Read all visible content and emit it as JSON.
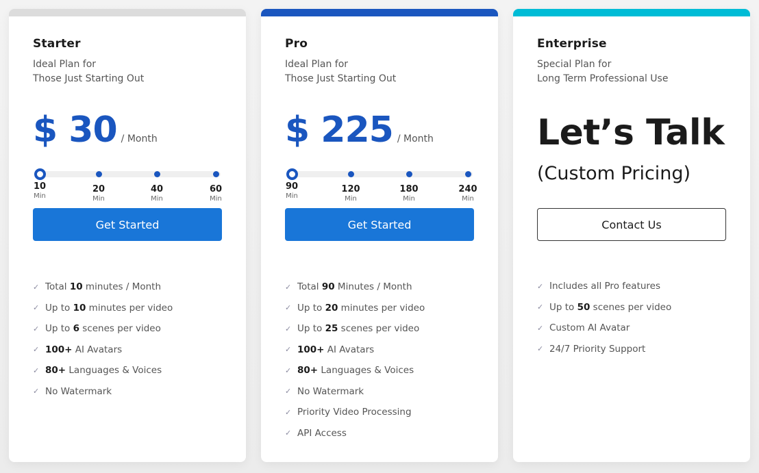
{
  "plans": [
    {
      "name": "Starter",
      "desc_line1": "Ideal Plan for",
      "desc_line2": "Those Just Starting Out",
      "price": "$ 30",
      "price_unit": "/ Month",
      "slider": {
        "selected_index": 0,
        "stops": [
          {
            "value": "10",
            "unit": "Min"
          },
          {
            "value": "20",
            "unit": "Min"
          },
          {
            "value": "40",
            "unit": "Min"
          },
          {
            "value": "60",
            "unit": "Min"
          }
        ]
      },
      "cta": "Get Started",
      "accent": "#dcdcdc",
      "features": [
        {
          "pre": "Total ",
          "bold": "10",
          "post": " minutes / Month"
        },
        {
          "pre": "Up to ",
          "bold": "10",
          "post": " minutes per video"
        },
        {
          "pre": "Up to ",
          "bold": "6",
          "post": " scenes per video"
        },
        {
          "pre": "",
          "bold": "100+",
          "post": " AI Avatars"
        },
        {
          "pre": "",
          "bold": "80+",
          "post": " Languages & Voices"
        },
        {
          "pre": "No Watermark",
          "bold": "",
          "post": ""
        }
      ]
    },
    {
      "name": "Pro",
      "desc_line1": "Ideal Plan for",
      "desc_line2": "Those Just Starting Out",
      "price": "$ 225",
      "price_unit": "/ Month",
      "slider": {
        "selected_index": 0,
        "stops": [
          {
            "value": "90",
            "unit": "Min"
          },
          {
            "value": "120",
            "unit": "Min"
          },
          {
            "value": "180",
            "unit": "Min"
          },
          {
            "value": "240",
            "unit": "Min"
          }
        ]
      },
      "cta": "Get Started",
      "accent": "#1a56bf",
      "features": [
        {
          "pre": "Total ",
          "bold": "90",
          "post": " Minutes / Month"
        },
        {
          "pre": "Up to ",
          "bold": "20",
          "post": " minutes per video"
        },
        {
          "pre": "Up to ",
          "bold": "25",
          "post": " scenes per video"
        },
        {
          "pre": "",
          "bold": "100+",
          "post": " AI Avatars"
        },
        {
          "pre": "",
          "bold": "80+",
          "post": " Languages & Voices"
        },
        {
          "pre": "No Watermark",
          "bold": "",
          "post": ""
        },
        {
          "pre": "Priority Video Processing",
          "bold": "",
          "post": ""
        },
        {
          "pre": "API Access",
          "bold": "",
          "post": ""
        }
      ]
    },
    {
      "name": "Enterprise",
      "desc_line1": "Special Plan for",
      "desc_line2": "Long Term Professional Use",
      "headline": "Let’s Talk",
      "subheadline": "(Custom Pricing)",
      "cta": "Contact Us",
      "accent": "#00bcd6",
      "features": [
        {
          "pre": "Includes all Pro features",
          "bold": "",
          "post": ""
        },
        {
          "pre": "Up to ",
          "bold": "50",
          "post": " scenes per video"
        },
        {
          "pre": "Custom AI Avatar",
          "bold": "",
          "post": ""
        },
        {
          "pre": "24/7 Priority Support",
          "bold": "",
          "post": ""
        }
      ]
    }
  ],
  "icons": {
    "check": "✓"
  },
  "colors": {
    "primary_blue": "#1a56bf",
    "button_blue": "#1976d8",
    "enterprise_cyan": "#00bcd6",
    "starter_gray": "#dcdcdc"
  }
}
